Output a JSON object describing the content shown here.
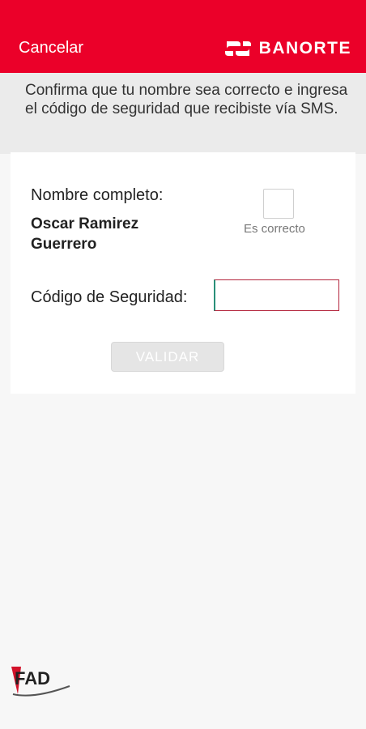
{
  "header": {
    "cancel_label": "Cancelar",
    "brand_name": "BANORTE",
    "brand_color": "#eb0029"
  },
  "intro": {
    "text": "Confirma que tu nombre sea correcto e ingresa el código de seguridad que recibiste vía SMS."
  },
  "form": {
    "name_label": "Nombre completo:",
    "name_value_line1": "Oscar Ramirez",
    "name_value_line2": "Guerrero",
    "confirm_label": "Es correcto",
    "confirm_checked": false,
    "code_label": "Código de Seguridad:",
    "code_value": "",
    "validate_label": "VALIDAR",
    "validate_enabled": false
  },
  "footer": {
    "fad_logo_icon": "fad-logo-icon",
    "fad_text": "FAD"
  }
}
